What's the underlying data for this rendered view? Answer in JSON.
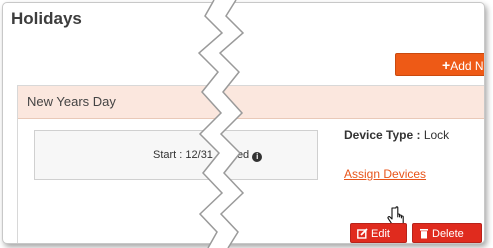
{
  "page": {
    "title": "Holidays"
  },
  "toolbar": {
    "add_label": "Add N",
    "add_icon": "plus-icon"
  },
  "holiday": {
    "name": "New Years Day",
    "date_text": "Start : 12/31",
    "date_suffix": "ed",
    "info_icon": "info-circle-icon",
    "device_type_label": "Device Type :",
    "device_type_value": "Lock",
    "assign_link": "Assign Devices"
  },
  "actions": {
    "edit_label": "Edit",
    "edit_icon": "edit-icon",
    "delete_label": "Delete",
    "delete_icon": "trash-icon"
  },
  "colors": {
    "accent": "#ee5a16",
    "danger": "#e02b1e",
    "header_bg": "#fbe7de",
    "link": "#e8551a"
  }
}
